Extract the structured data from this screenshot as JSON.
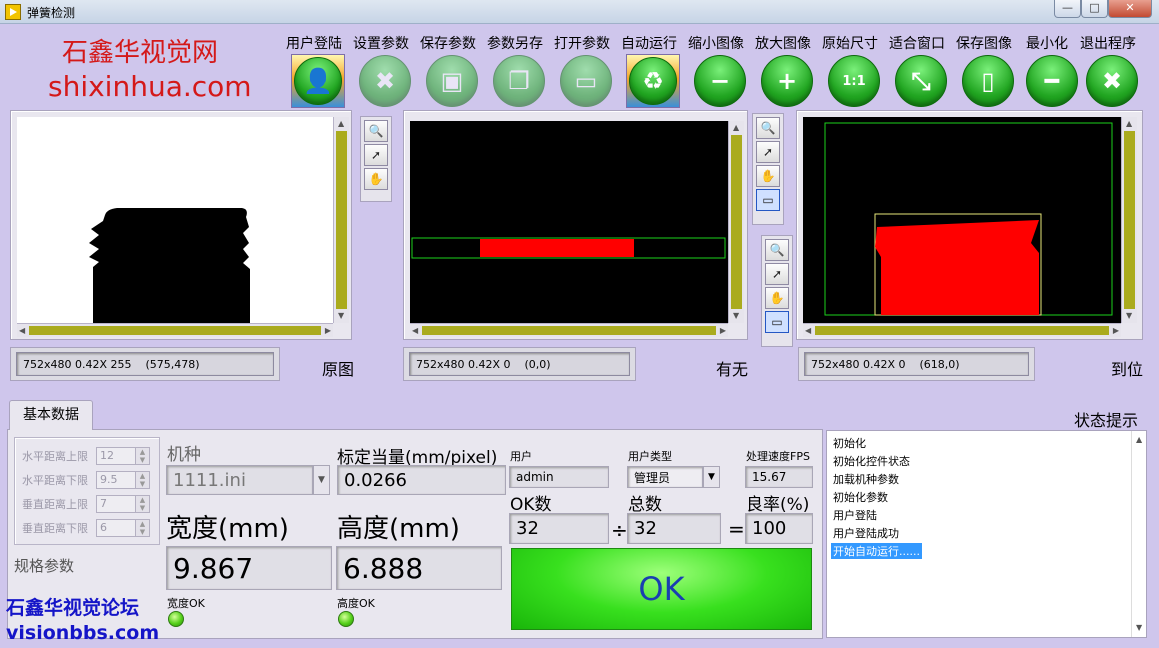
{
  "window": {
    "title": "弹簧检测",
    "btn_min": "—",
    "btn_max": "□",
    "btn_close": "✕"
  },
  "brand": {
    "name": "石鑫华视觉网",
    "site": "shixinhua.com"
  },
  "toolbar": [
    {
      "label": "用户登陆",
      "icon": "user-icon",
      "glyph": "👤",
      "style": "square"
    },
    {
      "label": "设置参数",
      "icon": "tools-icon",
      "glyph": "✖",
      "style": "dim"
    },
    {
      "label": "保存参数",
      "icon": "floppy-icon",
      "glyph": "▣",
      "style": "dim"
    },
    {
      "label": "参数另存",
      "icon": "copy-icon",
      "glyph": "❐",
      "style": "dim"
    },
    {
      "label": "打开参数",
      "icon": "folder-icon",
      "glyph": "▭",
      "style": "dim"
    },
    {
      "label": "自动运行",
      "icon": "recycle-icon",
      "glyph": "♻",
      "style": "square"
    },
    {
      "label": "缩小图像",
      "icon": "zoom-out-icon",
      "glyph": "−",
      "style": "normal"
    },
    {
      "label": "放大图像",
      "icon": "zoom-in-icon",
      "glyph": "+",
      "style": "normal"
    },
    {
      "label": "原始尺寸",
      "icon": "zoom-1-1-icon",
      "glyph": "1:1",
      "style": "normal"
    },
    {
      "label": "适合窗口",
      "icon": "zoom-fit-icon",
      "glyph": "⤡",
      "style": "normal"
    },
    {
      "label": "保存图像",
      "icon": "save-image-icon",
      "glyph": "▯",
      "style": "normal"
    },
    {
      "label": "最小化",
      "icon": "minimize-icon",
      "glyph": "━",
      "style": "normal"
    },
    {
      "label": "退出程序",
      "icon": "exit-icon",
      "glyph": "✖",
      "style": "normal"
    }
  ],
  "displays": [
    {
      "caption": "原图",
      "status": "752x480 0.42X 255    (575,478)"
    },
    {
      "caption": "有无",
      "status": "752x480 0.42X 0    (0,0)"
    },
    {
      "caption": "到位",
      "status": "752x480 0.42X 0    (618,0)"
    }
  ],
  "colors": {
    "detect": "#ff0000",
    "roi": "#1bd21b",
    "roi_yellow": "#e8e87a",
    "scroll": "#aaab1e"
  },
  "tab": {
    "label": "基本数据"
  },
  "spec": {
    "caption": "规格参数",
    "rows": [
      {
        "label": "水平距离上限",
        "value": "12"
      },
      {
        "label": "水平距离下限",
        "value": "9.5"
      },
      {
        "label": "垂直距离上限",
        "value": "7"
      },
      {
        "label": "垂直距离下限",
        "value": "6"
      }
    ]
  },
  "model": {
    "label": "机种",
    "value": "1111.ini"
  },
  "calib": {
    "label": "标定当量(mm/pixel)",
    "value": "0.0266"
  },
  "user": {
    "label": "用户",
    "value": "admin"
  },
  "user_type": {
    "label": "用户类型",
    "value": "管理员"
  },
  "fps": {
    "label": "处理速度FPS",
    "value": "15.67"
  },
  "ok_count": {
    "label": "OK数",
    "value": "32"
  },
  "total": {
    "label": "总数",
    "value": "32"
  },
  "yield": {
    "label": "良率(%)",
    "value": "100"
  },
  "ops": {
    "div": "÷",
    "eq": "="
  },
  "width": {
    "label": "宽度(mm)",
    "value": "9.867",
    "ok_label": "宽度OK"
  },
  "height": {
    "label": "高度(mm)",
    "value": "6.888",
    "ok_label": "高度OK"
  },
  "result": "OK",
  "status_title": "状态提示",
  "log": [
    "初始化",
    "初始化控件状态",
    "加载机种参数",
    "初始化参数",
    "用户登陆",
    "用户登陆成功",
    "开始自动运行......"
  ],
  "forum": {
    "name": "石鑫华视觉论坛",
    "site": "visionbbs.com"
  }
}
